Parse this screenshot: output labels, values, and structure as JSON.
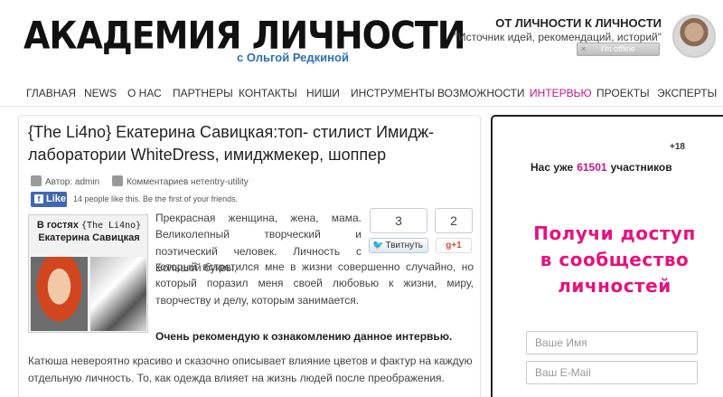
{
  "header": {
    "logo_main": "АКАДЕМИЯ ЛИЧНОСТИ",
    "logo_sub": "с Ольгой Редкиной",
    "tagline_1": "ОТ ЛИЧНОСТИ К ЛИЧНОСТИ",
    "tagline_2": "\"Источник идей, рекомендаций, историй\"",
    "status": "I'm offline",
    "status_close": "×"
  },
  "nav": {
    "items": [
      "ГЛАВНАЯ",
      "NEWS",
      "О НАС",
      "ПАРТНЕРЫ",
      "КОНТАКТЫ",
      "НИШИ",
      "ИНСТРУМЕНТЫ",
      "ВОЗМОЖНОСТИ",
      "ИНТЕРВЬЮ",
      "ПРОЕКТЫ",
      "ЭКСПЕРТЫ"
    ],
    "active": "ИНТЕРВЬЮ"
  },
  "article": {
    "title": "{The Li4no} Екатерина Савицкая:топ- стилист Имидж-лаборатории WhiteDress, имиджмекер, шоппер",
    "author": "Автор: admin",
    "comments": "Комментариев нетentry-utility",
    "fb_like": "Like",
    "fb_icon": "f",
    "fb_text": "14 people like this. Be the first of your friends.",
    "guest_prefix": "В гостях",
    "guest_tag": "{The Li4no}",
    "guest_name": "Екатерина Савицкая",
    "intro": "Прекрасная женщина, жена, мама. Великолепный творческий и поэтический человек. Личность с Большой буквы,",
    "intro_2": "который встретился мне в жизни совершенно случайно, но который поразил меня своей любовью к жизни, миру, творчеству и делу, которым занимается.",
    "recommend": "Очень рекомендую к ознакомлению данное интервью.",
    "para2": "Катюша невероятно красиво и сказочно описывает влияние цветов и фактур на каждую отдельную личность. То, как одежда влияет на жизнь людей после преображения."
  },
  "share": {
    "tweet_count": "3",
    "tweet_label": "Твитнуть",
    "gplus_count": "2",
    "gplus_label": "g+1"
  },
  "sidebar": {
    "plus18": "+18",
    "members_prefix": "Нас уже",
    "members_count": "61501",
    "members_suffix": "участников",
    "cta": "Получи доступ в сообщество личностей",
    "name_placeholder": "Ваше Имя",
    "email_placeholder": "Ваш E-Mail"
  },
  "colors": {
    "accent": "#c5178a",
    "cta": "#e6127f",
    "link": "#2f6fb3",
    "facebook": "#4267b2"
  }
}
